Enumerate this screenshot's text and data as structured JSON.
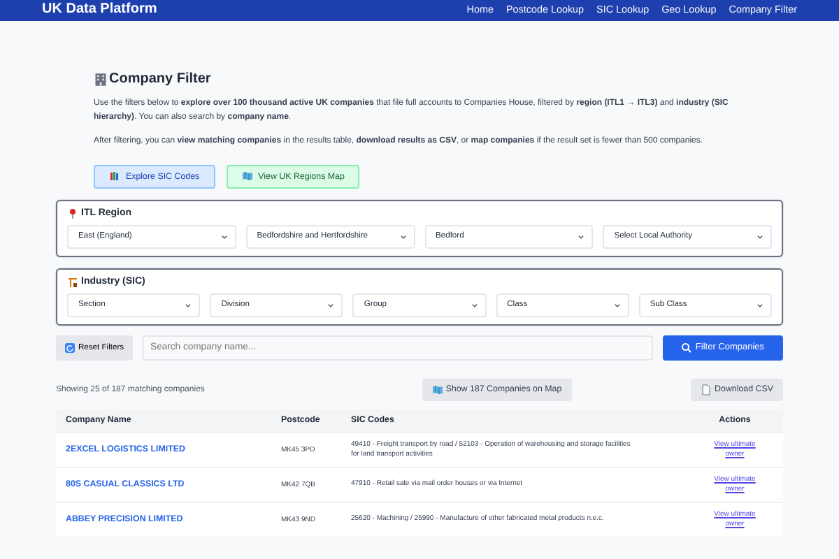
{
  "navbar": {
    "brand": "UK Data Platform",
    "links": [
      "Home",
      "Postcode Lookup",
      "SIC Lookup",
      "Geo Lookup",
      "Company Filter"
    ]
  },
  "heading": "Company Filter",
  "intro": [
    "Use the filters below to **explore over 100 thousand active UK companies** that file full accounts to Companies House, filtered by **region (ITL1 → ITL3)** and **industry (SIC hierarchy)**. You can also search by **company name**.",
    "After filtering, you can **view matching companies** in the results table, **download results as CSV**, or **map companies** if the result set is fewer than 500 companies."
  ],
  "quick_links": [
    {
      "label": "Explore SIC Codes",
      "kind": "sic"
    },
    {
      "label": "View UK Regions Map",
      "kind": "map"
    }
  ],
  "filter_groups": [
    {
      "title": "ITL Region",
      "kind": "region",
      "selects": [
        "East (England)",
        "Bedfordshire and Hertfordshire",
        "Bedford",
        "Select Local Authority"
      ]
    },
    {
      "title": "Industry (SIC)",
      "kind": "industry",
      "selects": [
        "Section",
        "Division",
        "Group",
        "Class",
        "Sub Class"
      ]
    }
  ],
  "reset_button": "Reset Filters",
  "search": {
    "placeholder": "Search company name..."
  },
  "filter_button": "Filter Companies",
  "result_count": "Showing 25 of 187 matching companies",
  "map_button": "Show 187 Companies on Map",
  "csv_button": "Download CSV",
  "table": {
    "columns": [
      "Company Name",
      "Postcode",
      "SIC Codes",
      "Actions"
    ],
    "rows": [
      {
        "name": "2EXCEL LOGISTICS LIMITED",
        "postcode": "MK45 3PD",
        "sic": "49410 - Freight transport by road / 52103 - Operation of warehousing and storage facilities for land transport activities",
        "action": "View ultimate owner"
      },
      {
        "name": "80S CASUAL CLASSICS LTD",
        "postcode": "MK42 7QB",
        "sic": "47910 - Retail sale via mail order houses or via Internet",
        "action": "View ultimate owner"
      },
      {
        "name": "ABBEY PRECISION LIMITED",
        "postcode": "MK43 9ND",
        "sic": "25620 - Machining / 25990 - Manufacture of other fabricated metal products n.e.c.",
        "action": "View ultimate owner"
      }
    ]
  }
}
